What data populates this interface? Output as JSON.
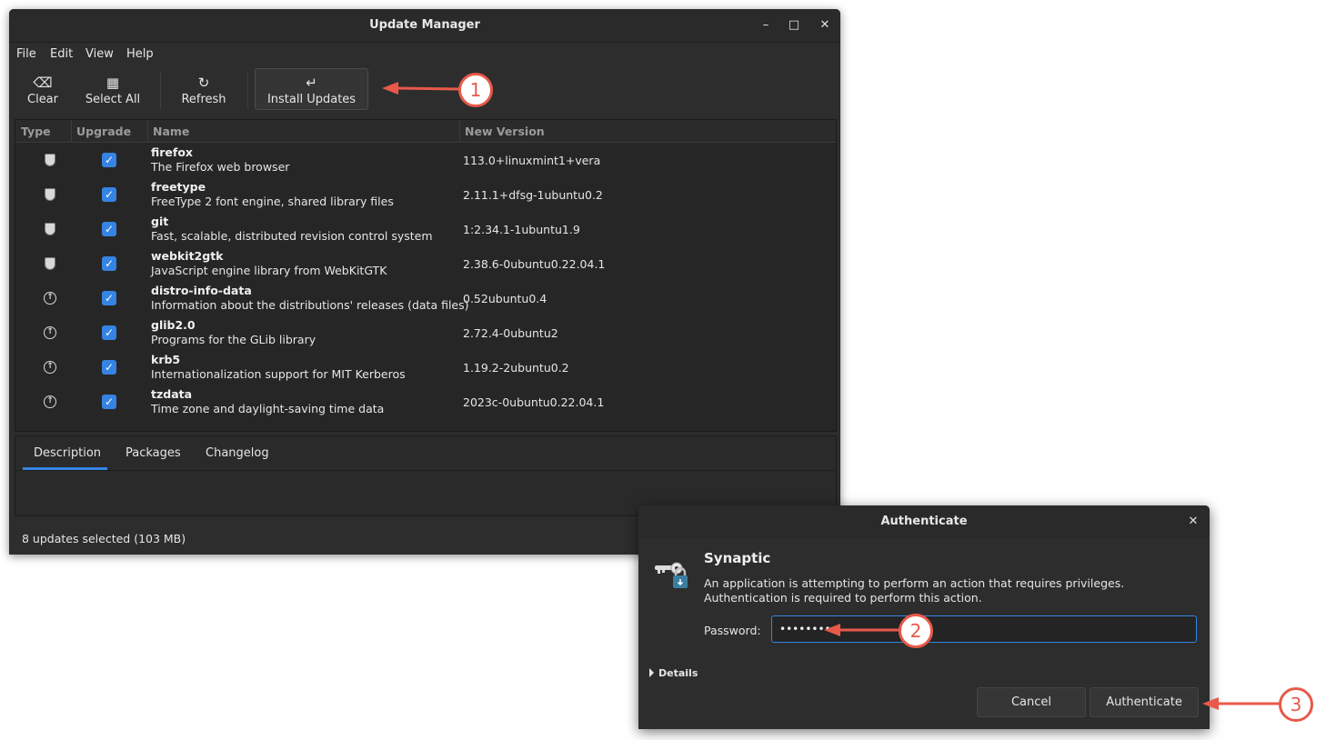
{
  "update_manager": {
    "title": "Update Manager",
    "menu": [
      "File",
      "Edit",
      "View",
      "Help"
    ],
    "toolbar": {
      "clear": "Clear",
      "select_all": "Select All",
      "refresh": "Refresh",
      "install": "Install Updates"
    },
    "columns": [
      "Type",
      "Upgrade",
      "Name",
      "New Version"
    ],
    "packages": [
      {
        "type": "security",
        "name": "firefox",
        "desc": "The Firefox web browser",
        "version": "113.0+linuxmint1+vera"
      },
      {
        "type": "security",
        "name": "freetype",
        "desc": "FreeType 2 font engine, shared library files",
        "version": "2.11.1+dfsg-1ubuntu0.2"
      },
      {
        "type": "security",
        "name": "git",
        "desc": "Fast, scalable, distributed revision control system",
        "version": "1:2.34.1-1ubuntu1.9"
      },
      {
        "type": "security",
        "name": "webkit2gtk",
        "desc": "JavaScript engine library from WebKitGTK",
        "version": "2.38.6-0ubuntu0.22.04.1"
      },
      {
        "type": "upgrade",
        "name": "distro-info-data",
        "desc": "Information about the distributions' releases (data files)",
        "version": "0.52ubuntu0.4"
      },
      {
        "type": "upgrade",
        "name": "glib2.0",
        "desc": "Programs for the GLib library",
        "version": "2.72.4-0ubuntu2"
      },
      {
        "type": "upgrade",
        "name": "krb5",
        "desc": "Internationalization support for MIT Kerberos",
        "version": "1.19.2-2ubuntu0.2"
      },
      {
        "type": "upgrade",
        "name": "tzdata",
        "desc": "Time zone and daylight-saving time data",
        "version": "2023c-0ubuntu0.22.04.1"
      }
    ],
    "tabs": [
      "Description",
      "Packages",
      "Changelog"
    ],
    "status": "8 updates selected (103 MB)"
  },
  "auth_dialog": {
    "title": "Authenticate",
    "app_name": "Synaptic",
    "message": "An application is attempting to perform an action that requires privileges. Authentication is required to perform this action.",
    "password_label": "Password:",
    "password_value": "••••••••",
    "details_label": "Details",
    "cancel": "Cancel",
    "authenticate": "Authenticate"
  },
  "annotations": [
    "1",
    "2",
    "3"
  ],
  "colors": {
    "accent": "#3584e4",
    "annotation": "#e8594a",
    "window_bg": "#2d2d2d"
  }
}
